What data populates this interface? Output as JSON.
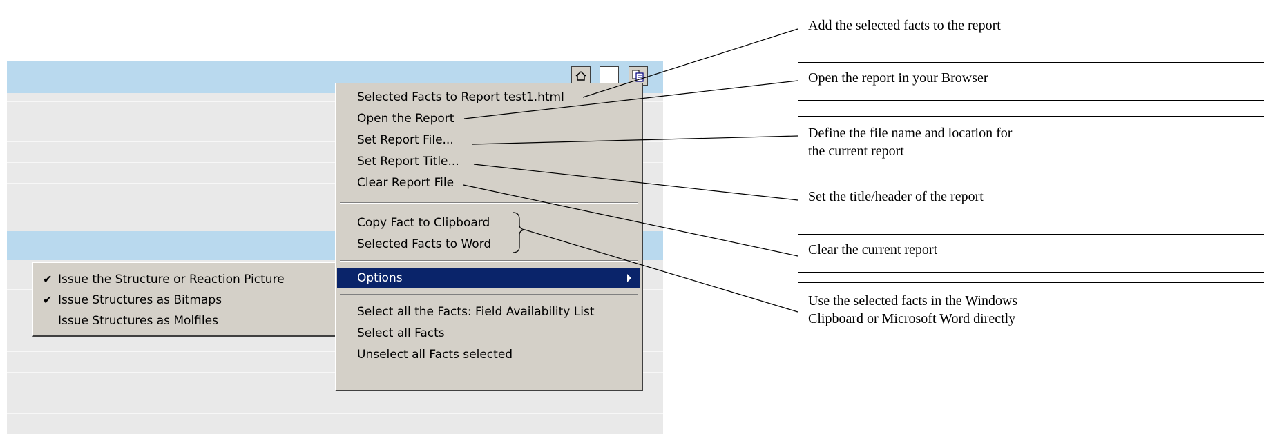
{
  "menu": {
    "items": [
      {
        "label": "Selected Facts to Report test1.html"
      },
      {
        "label": "Open the Report"
      },
      {
        "label": "Set Report File..."
      },
      {
        "label": "Set Report Title..."
      },
      {
        "label": "Clear Report File"
      },
      {
        "label": "Copy Fact to Clipboard"
      },
      {
        "label": "Selected Facts to Word"
      },
      {
        "label": "Options"
      },
      {
        "label": "Select all the Facts: Field Availability List"
      },
      {
        "label": "Select all Facts"
      },
      {
        "label": "Unselect all Facts selected"
      }
    ]
  },
  "submenu": {
    "items": [
      {
        "label": "Issue the Structure or Reaction Picture",
        "checked": true
      },
      {
        "label": "Issue Structures as Bitmaps",
        "checked": true
      },
      {
        "label": "Issue Structures as Molfiles",
        "checked": false
      }
    ]
  },
  "callouts": [
    {
      "text": "Add the selected facts to the report"
    },
    {
      "text": "Open the report in your Browser"
    },
    {
      "line1": "Define the file name and location for",
      "line2": "the current report"
    },
    {
      "text": "Set the title/header of the report"
    },
    {
      "text": "Clear the current report"
    },
    {
      "line1": "Use the selected facts in the Windows",
      "line2": "Clipboard or Microsoft Word directly"
    }
  ],
  "toolbar": {
    "icons": [
      "home-icon",
      "blank-page-icon",
      "copy-report-icon"
    ]
  },
  "colors": {
    "menu_bg": "#d4d0c8",
    "highlight": "#0a246a",
    "band": "#b9d9ee",
    "grid_bg": "#e9e9e9"
  }
}
